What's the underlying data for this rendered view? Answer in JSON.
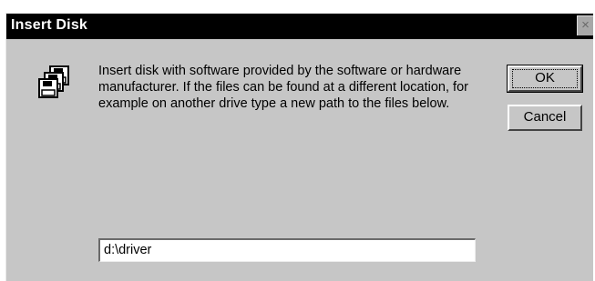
{
  "dialog": {
    "title": "Insert Disk",
    "close_label": "×",
    "icon": "floppy-disks-icon",
    "message": "Insert disk with software provided by the software or hardware manufacturer.  If the files can be found at a different location, for example on another drive type a new path to the files below.",
    "ok_label": "OK",
    "cancel_label": "Cancel",
    "path_value": "d:\\driver"
  },
  "colors": {
    "dialog_bg": "#c6c6c6",
    "titlebar_bg": "#000000",
    "title_text": "#ffffff"
  }
}
